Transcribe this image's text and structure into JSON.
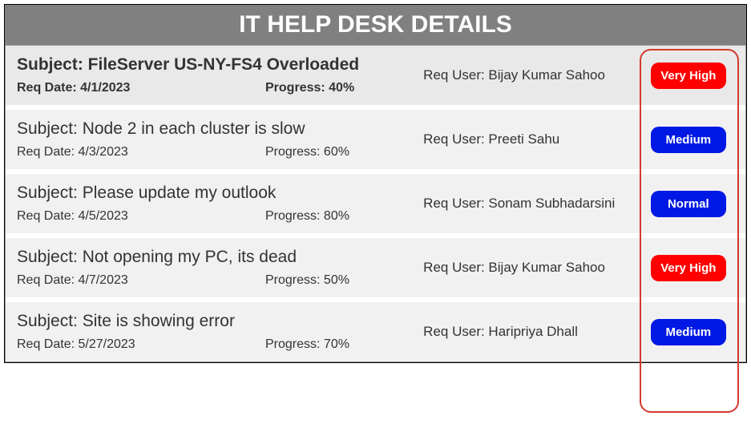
{
  "header": {
    "title": "IT HELP DESK DETAILS"
  },
  "labels": {
    "subject_prefix": "Subject: ",
    "req_date_prefix": "Req Date: ",
    "progress_prefix": "Progress: ",
    "req_user_prefix": "Req User: "
  },
  "priority_colors": {
    "Very High": "#ff0000",
    "Medium": "#0018e4",
    "Normal": "#0018e4"
  },
  "tickets": [
    {
      "subject": "FileServer US-NY-FS4 Overloaded",
      "req_date": "4/1/2023",
      "progress": "40%",
      "req_user": "Bijay Kumar Sahoo",
      "priority": "Very High",
      "selected": true
    },
    {
      "subject": "Node 2 in each cluster is slow",
      "req_date": "4/3/2023",
      "progress": "60%",
      "req_user": "Preeti Sahu",
      "priority": "Medium",
      "selected": false
    },
    {
      "subject": "Please update my outlook",
      "req_date": "4/5/2023",
      "progress": "80%",
      "req_user": "Sonam Subhadarsini",
      "priority": "Normal",
      "selected": false
    },
    {
      "subject": "Not opening my PC, its dead",
      "req_date": "4/7/2023",
      "progress": "50%",
      "req_user": "Bijay Kumar Sahoo",
      "priority": "Very High",
      "selected": false
    },
    {
      "subject": "Site is showing error",
      "req_date": "5/27/2023",
      "progress": "70%",
      "req_user": "Haripriya Dhall",
      "priority": "Medium",
      "selected": false
    }
  ]
}
